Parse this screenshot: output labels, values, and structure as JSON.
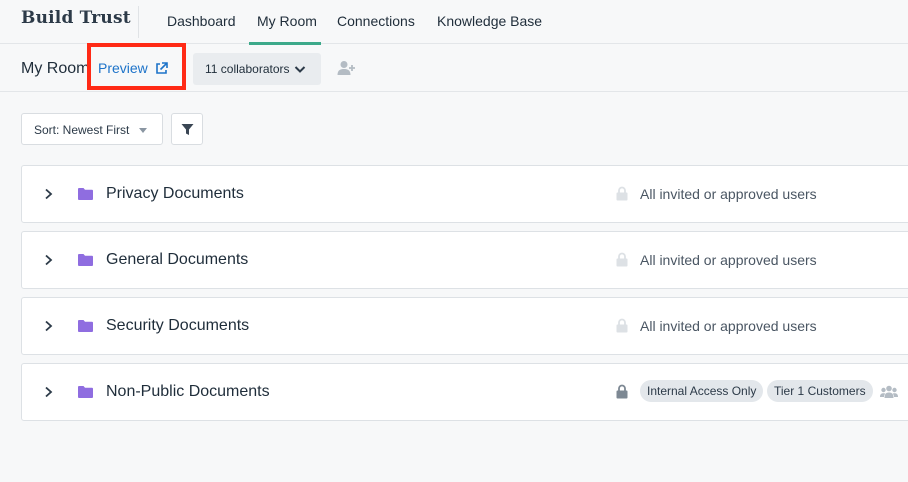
{
  "brand": "Build Trust",
  "nav": {
    "items": [
      {
        "label": "Dashboard"
      },
      {
        "label": "My Room"
      },
      {
        "label": "Connections"
      },
      {
        "label": "Knowledge Base"
      }
    ],
    "active": "My Room"
  },
  "subheader": {
    "room_title": "My Room",
    "preview_label": "Preview",
    "collaborators_label": "11 collaborators"
  },
  "toolbar": {
    "sort_label": "Sort: Newest First"
  },
  "folders": [
    {
      "title": "Privacy Documents",
      "access": "All invited or approved users"
    },
    {
      "title": "General Documents",
      "access": "All invited or approved users"
    },
    {
      "title": "Security Documents",
      "access": "All invited or approved users"
    },
    {
      "title": "Non-Public Documents",
      "badges": [
        "Internal Access Only",
        "Tier 1 Customers"
      ]
    }
  ],
  "colors": {
    "accent": "#3ca98a",
    "link": "#1d73c9",
    "folder": "#8f6de0",
    "highlight": "#ff2a16"
  }
}
